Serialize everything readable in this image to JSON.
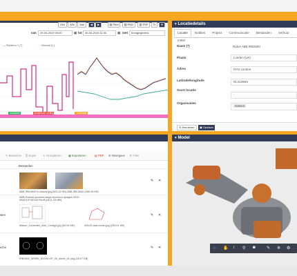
{
  "chart_toolbar": {
    "range_buttons": [
      "24h",
      "48h",
      "1wk"
    ],
    "nav_prev": "◀",
    "nav_next": "▶",
    "print_label": "Print",
    "png_label": "PNG",
    "pdf_label": "PDF"
  },
  "chart_filter": {
    "from_label": "van",
    "from_value": "29-04-2019 00:00",
    "to_label": "tot",
    "to_value": "30-04-2019 11:00",
    "with_label": "met",
    "with_value": "brongegevens"
  },
  "chart_legend": [
    "Relation Y [°]",
    "Manual [L]"
  ],
  "chart_annotations": [
    "Installatie",
    "Afwijkende meting",
    "Kalibratie"
  ],
  "chart_data": {
    "type": "line",
    "series": [
      {
        "name": "Relation Y [°]",
        "color": "#c2006f"
      },
      {
        "name": "Manual [L]",
        "color": "#e9a0b8"
      }
    ]
  },
  "location": {
    "title": "Locatiedetails",
    "tabs": [
      "Locatie",
      "Notities",
      "Project",
      "Communicatie",
      "Bestanden",
      "Verhuur",
      "Instel"
    ],
    "fields": [
      {
        "label": "Naam (*)",
        "value": "Robot ABB IRB2600"
      },
      {
        "label": "Plaats",
        "value": "Londen (UK)"
      },
      {
        "label": "Adres",
        "value": "NYU London"
      },
      {
        "label": "Latitude/longitude",
        "value": "51.519869"
      },
      {
        "label": "Soort locatie",
        "value": "-"
      },
      {
        "label": "Organisaties",
        "value": "Gatsen"
      }
    ],
    "btn_annuleren": "Annuleren",
    "btn_opslaan": "Opslaan"
  },
  "attachments": {
    "toolbar": [
      "Bewerken",
      "Kopie",
      "Verwijderen",
      "Exporteren",
      "PDF",
      "Weergave",
      "Filter"
    ],
    "col_files": "Bestanden",
    "rows": [
      {
        "files": "ABB IRB 6640 in factory.jpg (523.32 KB) ABB IRB 6640 (280.49 KB)"
      },
      {
        "files": "ABB-Robotic-product-range-brochure-4pages-2019-9AKK107492A9-Rev8.pdf (1.33 MB)",
        "extra": "Motion_Controller_Axis_Config4.jpg (63.26 KB)",
        "extra2": "4N120-wall-model.jpg (239.01 KB)",
        "side": "sten"
      },
      {
        "files": "IRB2600_WORK_ENVELOP_00_sheet_01.png (18.27 KB)",
        "side": "eche"
      }
    ]
  },
  "model": {
    "title": "Model"
  }
}
